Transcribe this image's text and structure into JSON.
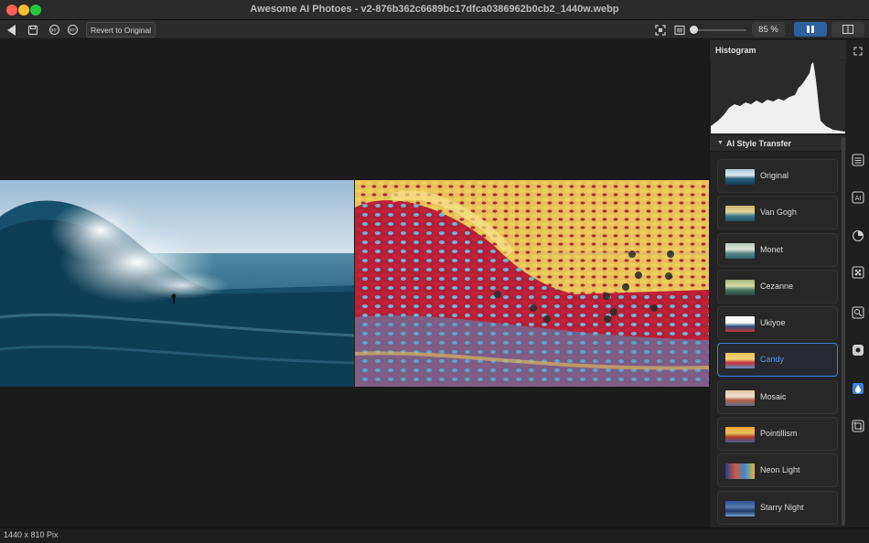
{
  "window": {
    "title": "Awesome AI Photoes  - v2-876b362c6689bc17dfca0386962b0cb2_1440w.webp"
  },
  "toolbar": {
    "back_icon": "back-arrow-icon",
    "save_icon": "save-icon",
    "rotate_left_icon": "rotate-left-icon",
    "rotate_right_icon": "rotate-right-icon",
    "revert_label": "Revert to Original",
    "fit_icon": "fit-to-screen-icon",
    "compare_icon": "compare-icon",
    "zoom_value": "85 %",
    "zoom_slider_level": 0.0,
    "view_split_icon": "split-view-icon",
    "view_side_icon": "side-by-side-icon"
  },
  "status": {
    "dimensions": "1440 x 810 Pix"
  },
  "panel": {
    "histogram_title": "Histogram",
    "expand_icon": "expand-icon",
    "section_title": "AI Style Transfer",
    "styles": [
      {
        "label": "Original",
        "selected": false
      },
      {
        "label": "Van Gogh",
        "selected": false
      },
      {
        "label": "Monet",
        "selected": false
      },
      {
        "label": "Cezanne",
        "selected": false
      },
      {
        "label": "Ukiyoe",
        "selected": false
      },
      {
        "label": "Candy",
        "selected": true
      },
      {
        "label": "Mosaic",
        "selected": false
      },
      {
        "label": "Pointillism",
        "selected": false
      },
      {
        "label": "Neon Light",
        "selected": false
      },
      {
        "label": "Starry Night",
        "selected": false
      }
    ]
  },
  "rail": {
    "icons": [
      "adjustments-icon",
      "ai-icon",
      "lens-icon",
      "pattern-icon",
      "zoom-region-icon",
      "settings-icon",
      "style-drop-icon",
      "crop-icon"
    ]
  },
  "colors": {
    "accent": "#3f7fd9",
    "selected_label": "#4b97f0",
    "background": "#1e1e1e"
  }
}
